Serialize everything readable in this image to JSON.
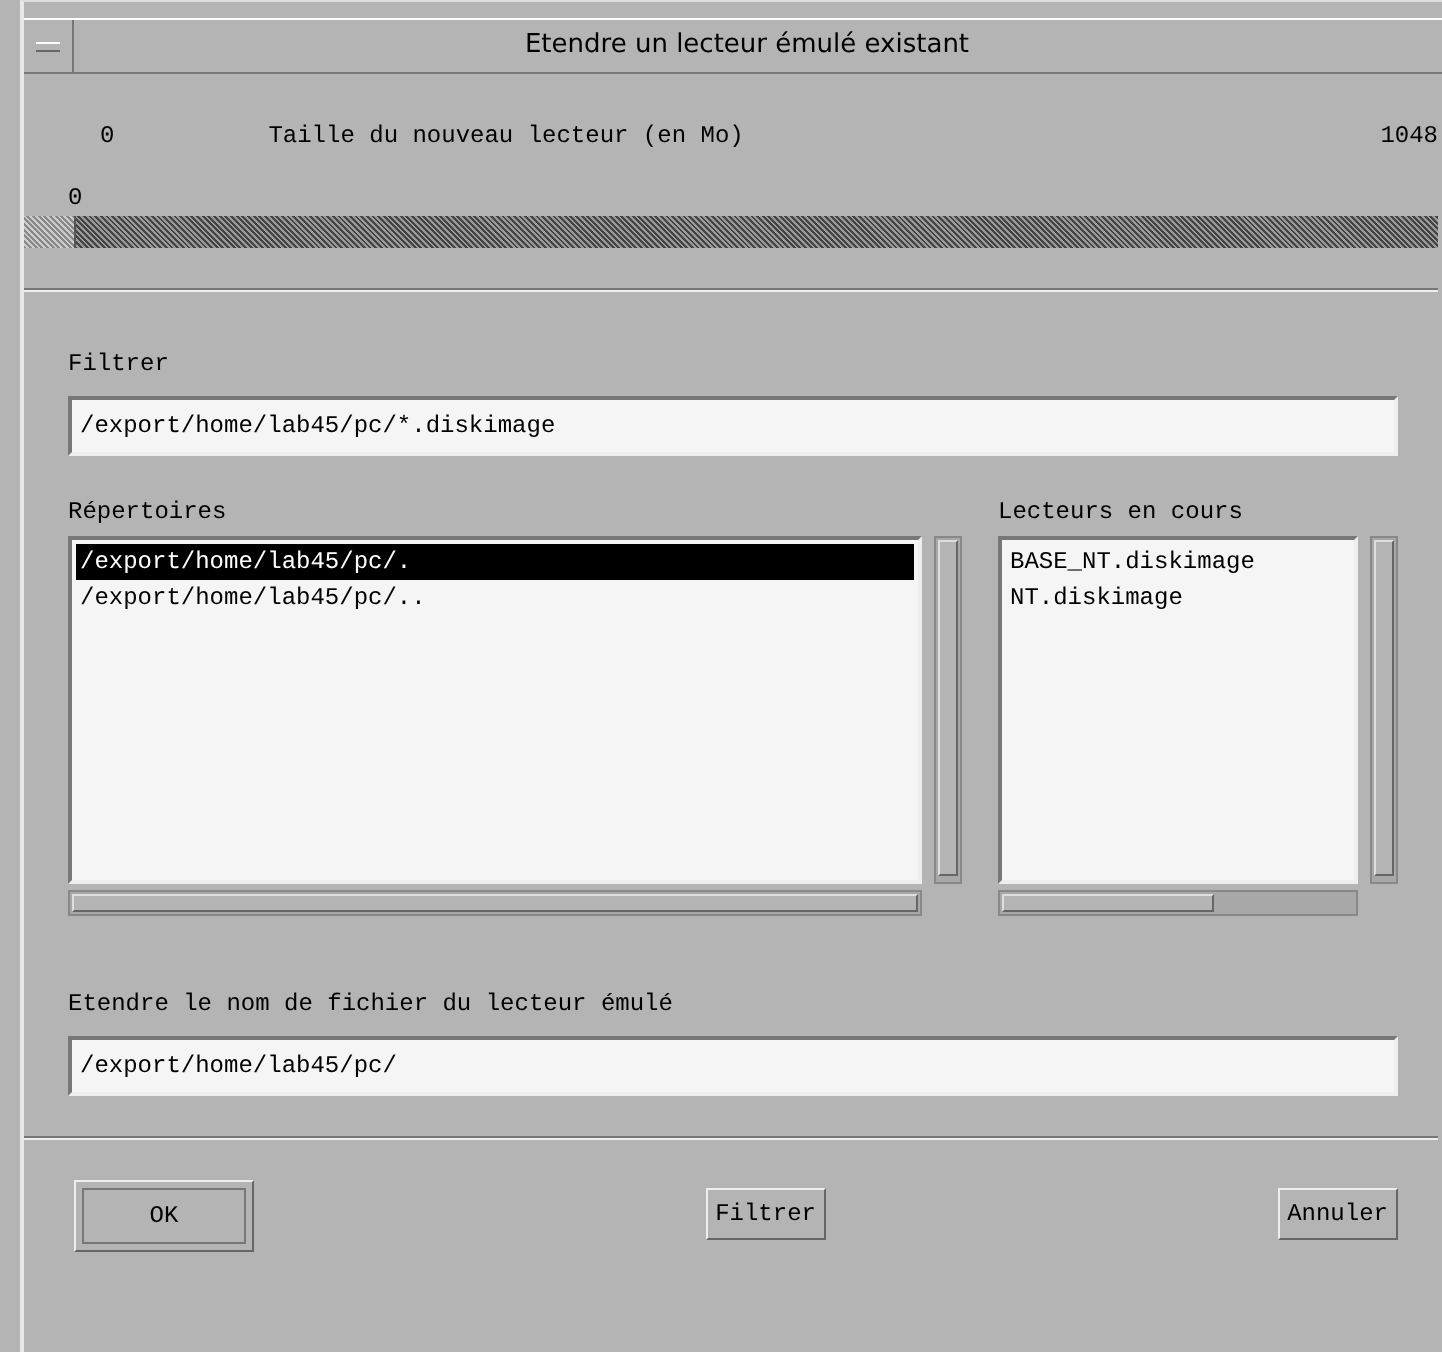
{
  "window": {
    "title": "Etendre un lecteur émulé existant"
  },
  "size_slider": {
    "min_label": "0",
    "label": "Taille du nouveau lecteur (en Mo)",
    "max_label": "1048",
    "value": "0",
    "level": 0
  },
  "filter": {
    "label": "Filtrer",
    "value": "/export/home/lab45/pc/*.diskimage"
  },
  "directories": {
    "label": "Répertoires",
    "items": [
      {
        "text": "/export/home/lab45/pc/.",
        "selected": true
      },
      {
        "text": "/export/home/lab45/pc/..",
        "selected": false
      }
    ]
  },
  "drives": {
    "label": "Lecteurs en cours",
    "items": [
      {
        "text": "BASE_NT.diskimage",
        "selected": false
      },
      {
        "text": "NT.diskimage",
        "selected": false
      }
    ]
  },
  "filename": {
    "label": "Etendre le nom de fichier du lecteur émulé",
    "value": "/export/home/lab45/pc/"
  },
  "buttons": [
    {
      "label": "OK",
      "default": true
    },
    {
      "label": "Filtrer",
      "default": false
    },
    {
      "label": "Annuler",
      "default": false
    }
  ]
}
